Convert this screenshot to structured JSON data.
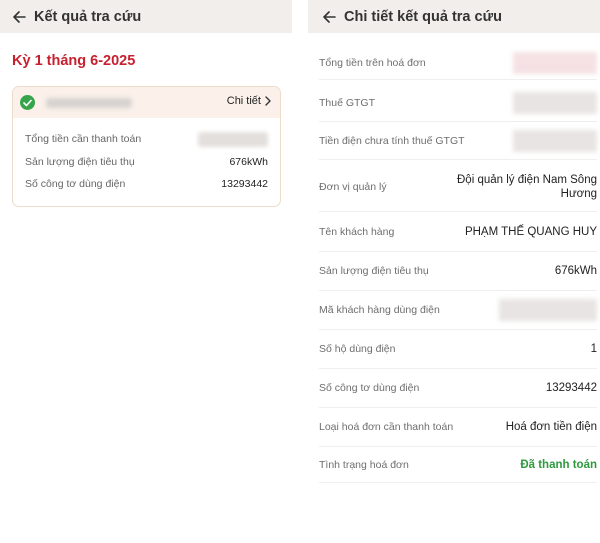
{
  "left": {
    "header_title": "Kết quả tra cứu",
    "period": "Kỳ 1 tháng 6-2025",
    "card": {
      "detail_label": "Chi tiết",
      "rows": [
        {
          "label": "Tổng tiền cần thanh toán",
          "value": ""
        },
        {
          "label": "Sản lượng điện tiêu thụ",
          "value": "676kWh"
        },
        {
          "label": "Số công tơ dùng điện",
          "value": "13293442"
        }
      ]
    }
  },
  "right": {
    "header_title": "Chi tiết kết quả tra cứu",
    "rows": [
      {
        "label": "Tổng tiền trên hoá đơn",
        "value": ""
      },
      {
        "label": "Thuế GTGT",
        "value": ""
      },
      {
        "label": "Tiền điện chưa tính thuế GTGT",
        "value": ""
      },
      {
        "label": "Đơn vị quản lý",
        "value": "Đội quản lý điện Nam Sông Hương"
      },
      {
        "label": "Tên khách hàng",
        "value": "PHẠM THẾ QUANG HUY"
      },
      {
        "label": "Sản lượng điện tiêu thụ",
        "value": "676kWh"
      },
      {
        "label": "Mã khách hàng dùng điện",
        "value": ""
      },
      {
        "label": "Số hộ dùng điện",
        "value": "1"
      },
      {
        "label": "Số công tơ dùng điện",
        "value": "13293442"
      },
      {
        "label": "Loại hoá đơn cần thanh toán",
        "value": "Hoá đơn tiền điện"
      },
      {
        "label": "Tình trạng hoá đơn",
        "value": "Đã thanh toán"
      }
    ]
  },
  "colors": {
    "accent_red": "#c8202e",
    "status_green": "#2d9a3e",
    "header_bg": "#f2eeeb"
  },
  "icons": [
    "back-arrow-icon",
    "check-circle-icon",
    "chevron-right-icon"
  ]
}
